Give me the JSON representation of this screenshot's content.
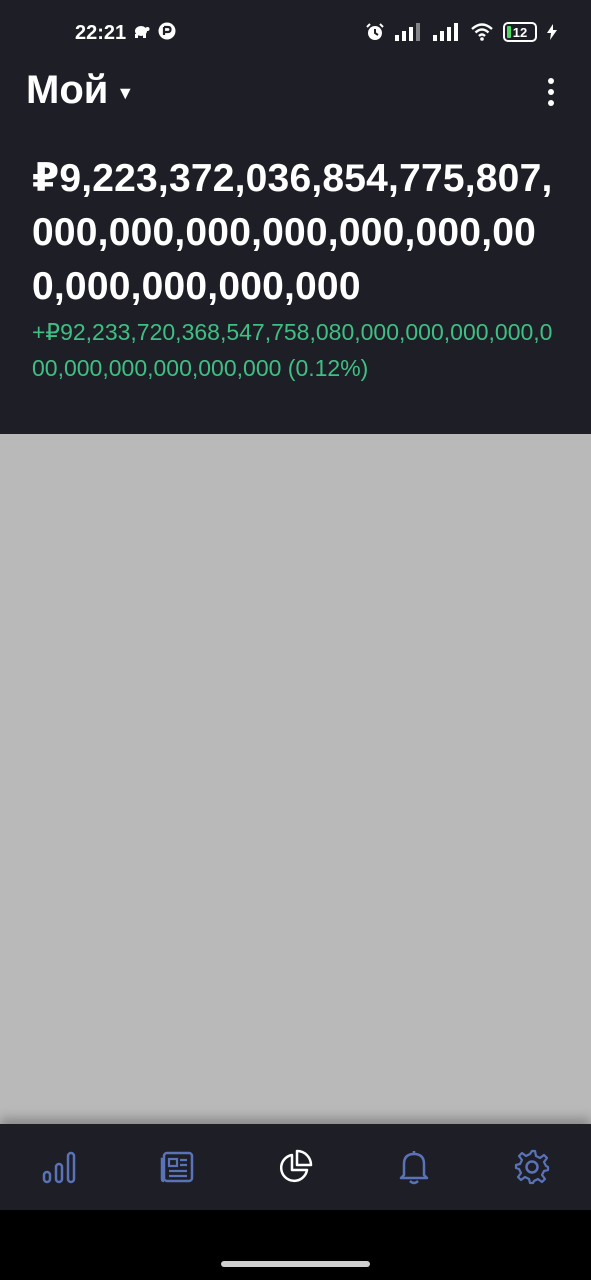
{
  "status_bar": {
    "time": "22:21",
    "battery_level": "12",
    "icons": [
      "turtle-icon",
      "app-notification-icon",
      "alarm-icon",
      "signal-icon",
      "signal-icon",
      "wifi-icon",
      "battery-icon",
      "charging-icon"
    ]
  },
  "header": {
    "title": "Мой",
    "total_value": "₽9,223,372,036,854,775,807,000,000,000,000,000,000,000,000,000,000,000",
    "change_text": "+₽92,233,720,368,547,758,080,000,000,000,000,000,000,000,000,000,000 (0.12%)"
  },
  "colors": {
    "background": "#1e1f26",
    "positive": "#3fbf83",
    "content_placeholder": "#b9b9b9",
    "nav_inactive": "#5a73b8",
    "nav_active": "#ffffff"
  },
  "bottom_nav": {
    "items": [
      {
        "icon": "bar-chart-icon",
        "active": false
      },
      {
        "icon": "news-icon",
        "active": false
      },
      {
        "icon": "pie-chart-icon",
        "active": true
      },
      {
        "icon": "bell-icon",
        "active": false
      },
      {
        "icon": "gear-icon",
        "active": false
      }
    ]
  }
}
